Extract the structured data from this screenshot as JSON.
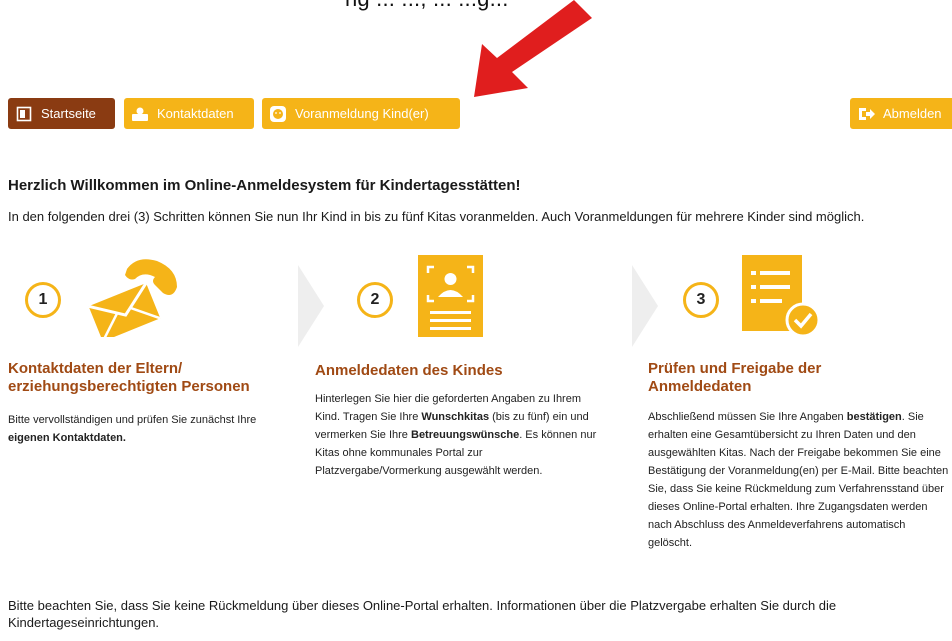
{
  "top_caption": "ng ... ..., ... ...g...",
  "nav": {
    "home": "Startseite",
    "contact": "Kontaktdaten",
    "preregistration": "Voranmeldung Kind(er)",
    "logout": "Abmelden"
  },
  "welcome_title": "Herzlich Willkommen im Online-Anmeldesystem für Kindertagesstätten!",
  "intro": "In den folgenden drei (3) Schritten können Sie nun Ihr Kind in bis zu fünf Kitas voranmelden. Auch Voranmeldungen für mehrere Kinder sind möglich.",
  "steps": [
    {
      "number": "1",
      "title_line1": "Kontaktdaten der Eltern/",
      "title_line2": "erziehungsberechtigten Personen",
      "text_a": "Bitte vervollständigen und prüfen Sie zunächst Ihre",
      "text_b": "eigenen Kontaktdaten."
    },
    {
      "number": "2",
      "title": "Anmeldedaten des Kindes",
      "text_a": "Hinterlegen Sie hier die geforderten Angaben zu Ihrem Kind. Tragen Sie Ihre",
      "text_b": "Wunschkitas",
      "text_c": "(bis zu fünf) ein und vermerken Sie Ihre",
      "text_d": "Betreuungswünsche",
      "text_e": ". Es können nur Kitas ohne kommunales Portal zur Platzvergabe/Vormerkung ausgewählt werden."
    },
    {
      "number": "3",
      "title_line1": "Prüfen und Freigabe der",
      "title_line2": "Anmeldedaten",
      "text_a": "Abschließend müssen Sie Ihre Angaben",
      "text_b": "bestätigen",
      "text_c": ". Sie erhalten eine Gesamtübersicht zu Ihren Daten und den ausgewählten Kitas. Nach der Freigabe bekommen Sie eine Bestätigung der Voranmeldung(en) per E-Mail. Bitte beachten Sie, dass Sie keine Rückmeldung zum Verfahrensstand über dieses Online-Portal erhalten. Ihre Zugangsdaten werden nach Abschluss des Anmeldeverfahrens automatisch gelöscht."
    }
  ],
  "footer": "Bitte beachten Sie, dass Sie keine Rückmeldung über dieses Online-Portal erhalten. Informationen über die Platzvergabe erhalten Sie durch die Kindertageseinrichtungen.",
  "colors": {
    "accent": "#f5b418",
    "brand_dark": "#8a3b12",
    "title": "#a04a14",
    "arrow": "#e01e1e",
    "chevron": "#eeeeee"
  },
  "icons": [
    "home-icon",
    "contact-icon",
    "child-icon",
    "logout-icon",
    "envelope-phone-icon",
    "id-card-icon",
    "checklist-icon",
    "chevron-right-icon",
    "red-arrow"
  ]
}
